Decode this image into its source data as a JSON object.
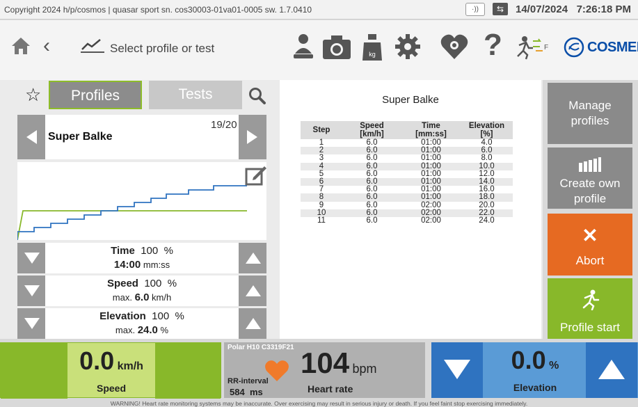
{
  "status_bar": {
    "copyright": "Copyright 2024 h/p/cosmos | quasar sport  sn. cos30003-01va01-0005  sw. 1.7.0410",
    "signal": "·))",
    "date": "14/07/2024",
    "time": "7:26:18 PM"
  },
  "nav": {
    "title": "Select profile or test",
    "icons": [
      "home-icon",
      "back-icon",
      "profile-chart-icon",
      "user-scale-icon",
      "camera-icon",
      "weight-kg-icon",
      "gear-icon",
      "heart-gear-icon",
      "help-icon",
      "runner-direction-icon"
    ],
    "kg_label": "kg",
    "direction_label": "F",
    "brand": "COSMED"
  },
  "tabs": {
    "profiles": "Profiles",
    "tests": "Tests"
  },
  "profile": {
    "name": "Super Balke",
    "counter": "19/20"
  },
  "controls": {
    "time": {
      "label": "Time",
      "percent": "100",
      "pct_unit": "%",
      "value": "14:00",
      "unit": "mm:ss"
    },
    "speed": {
      "label": "Speed",
      "percent": "100",
      "pct_unit": "%",
      "max_prefix": "max.",
      "value": "6.0",
      "unit": "km/h"
    },
    "elevation": {
      "label": "Elevation",
      "percent": "100",
      "pct_unit": "%",
      "max_prefix": "max.",
      "value": "24.0",
      "unit": "%"
    }
  },
  "table": {
    "title": "Super Balke",
    "headers": [
      [
        "Step",
        ""
      ],
      [
        "Speed",
        "[km/h]"
      ],
      [
        "Time",
        "[mm:ss]"
      ],
      [
        "Elevation",
        "[%]"
      ]
    ],
    "rows": [
      [
        "1",
        "6.0",
        "01:00",
        "4.0"
      ],
      [
        "2",
        "6.0",
        "01:00",
        "6.0"
      ],
      [
        "3",
        "6.0",
        "01:00",
        "8.0"
      ],
      [
        "4",
        "6.0",
        "01:00",
        "10.0"
      ],
      [
        "5",
        "6.0",
        "01:00",
        "12.0"
      ],
      [
        "6",
        "6.0",
        "01:00",
        "14.0"
      ],
      [
        "7",
        "6.0",
        "01:00",
        "16.0"
      ],
      [
        "8",
        "6.0",
        "01:00",
        "18.0"
      ],
      [
        "9",
        "6.0",
        "02:00",
        "20.0"
      ],
      [
        "10",
        "6.0",
        "02:00",
        "22.0"
      ],
      [
        "11",
        "6.0",
        "02:00",
        "24.0"
      ]
    ]
  },
  "right_buttons": {
    "manage": [
      "Manage",
      "profiles"
    ],
    "create": [
      "Create own",
      "profile"
    ],
    "abort": "Abort",
    "start": "Profile start"
  },
  "bottom": {
    "speed": {
      "value": "0.0",
      "unit": "km/h",
      "label": "Speed"
    },
    "hr": {
      "device": "Polar H10 C3319F21",
      "rr_label": "RR-interval",
      "rr_value": "584",
      "rr_unit": "ms",
      "value": "104",
      "unit": "bpm",
      "label": "Heart rate"
    },
    "elevation": {
      "value": "0.0",
      "unit": "%",
      "label": "Elevation"
    }
  },
  "warning": "WARNING! Heart rate monitoring systems may be inaccurate. Over exercising may result in serious injury or death. If you feel faint stop exercising immediately.",
  "colors": {
    "green": "#88b82a",
    "light_green": "#c9e07a",
    "orange": "#e66a22",
    "blue": "#2f73c0",
    "light_blue": "#5a9bd6",
    "grey_button": "#8a8a8a",
    "heart": "#f07a2a"
  }
}
